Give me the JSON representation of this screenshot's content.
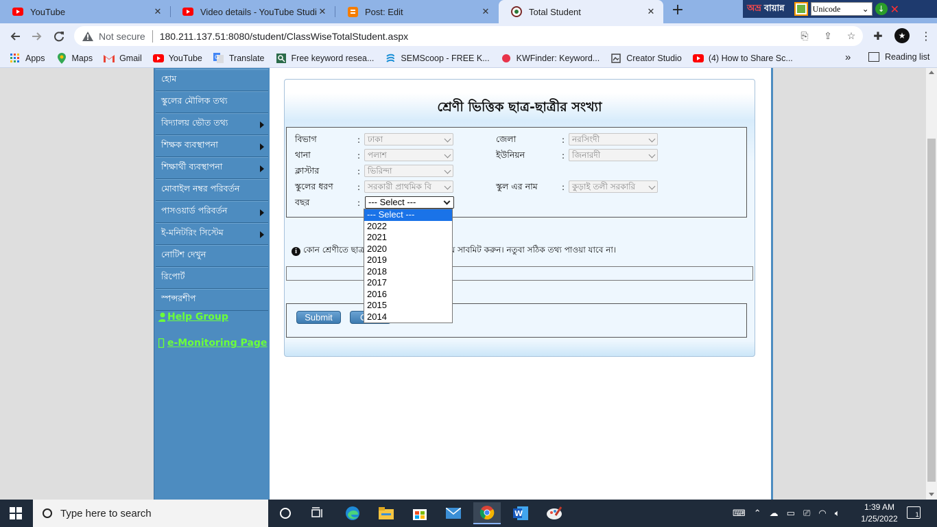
{
  "browser": {
    "tabs": [
      {
        "title": "YouTube",
        "icon": "youtube-icon",
        "active": false
      },
      {
        "title": "Video details - YouTube Studio",
        "icon": "youtube-icon",
        "active": false
      },
      {
        "title": "Post: Edit",
        "icon": "blogger-icon",
        "active": false
      },
      {
        "title": "Total Student",
        "icon": "site-logo-icon",
        "active": true
      }
    ],
    "not_secure_label": "Not secure",
    "url": "180.211.137.51:8080/student/ClassWiseTotalStudent.aspx",
    "bookmarks": [
      {
        "label": "Apps",
        "icon": "apps-grid-icon"
      },
      {
        "label": "Maps",
        "icon": "maps-pin-icon"
      },
      {
        "label": "Gmail",
        "icon": "gmail-icon"
      },
      {
        "label": "YouTube",
        "icon": "youtube-icon"
      },
      {
        "label": "Translate",
        "icon": "translate-icon"
      },
      {
        "label": "Free keyword resea...",
        "icon": "keyword-icon"
      },
      {
        "label": "SEMScoop - FREE K...",
        "icon": "semscoop-icon"
      },
      {
        "label": "KWFinder: Keyword...",
        "icon": "kwfinder-icon"
      },
      {
        "label": "Creator Studio",
        "icon": "creator-studio-icon"
      },
      {
        "label": "(4) How to Share Sc...",
        "icon": "youtube-icon"
      }
    ],
    "reading_list_label": "Reading list",
    "more_bookmarks": "»"
  },
  "ime": {
    "logo_red": "অভ্র",
    "logo_white": "বায়ান্ন",
    "encoding": "Unicode"
  },
  "sidebar": {
    "items": [
      {
        "label": "হোম",
        "has_submenu": false
      },
      {
        "label": "স্কুলের মৌলিক তথ্য",
        "has_submenu": false
      },
      {
        "label": "বিদ্যালয় ভৌত তথ্য",
        "has_submenu": true
      },
      {
        "label": "শিক্ষক ব্যবস্থাপনা",
        "has_submenu": true
      },
      {
        "label": "শিক্ষার্থী ব্যবস্থাপনা",
        "has_submenu": true
      },
      {
        "label": "মোবাইল নম্বর পরিবর্তন",
        "has_submenu": false
      },
      {
        "label": "পাসওয়ার্ড পরিবর্তন",
        "has_submenu": true
      },
      {
        "label": "ই-মনিটরিং সিস্টেম",
        "has_submenu": true
      },
      {
        "label": "নোটিশ দেখুন",
        "has_submenu": false
      },
      {
        "label": "রিপোর্ট",
        "has_submenu": false
      },
      {
        "label": "স্পন্সরশীপ",
        "has_submenu": false
      }
    ],
    "help_group": "Help Group",
    "e_monitoring": "e-Monitoring Page"
  },
  "form": {
    "title": "শ্রেণী ভিত্তিক ছাত্র-ছাত্রীর সংখ্যা",
    "colon": ":",
    "fields": {
      "division": {
        "label": "বিভাগ",
        "value": "ঢাকা"
      },
      "district": {
        "label": "জেলা",
        "value": "নরসিংদী"
      },
      "thana": {
        "label": "থানা",
        "value": "পলাশ"
      },
      "union": {
        "label": "ইউনিয়ন",
        "value": "জিনারদী"
      },
      "cluster": {
        "label": "ক্লাস্টার",
        "value": "ভিরিন্দা"
      },
      "school_type": {
        "label": "স্কুলের ধরণ",
        "value": "সরকারী প্রাথমিক বি"
      },
      "school_name": {
        "label": "স্কুল এর নাম",
        "value": "কুড়াই তলী সরকারি"
      },
      "year": {
        "label": "বছর",
        "value": "--- Select ---"
      }
    },
    "year_options": [
      "--- Select ---",
      "2022",
      "2021",
      "2020",
      "2019",
      "2018",
      "2017",
      "2016",
      "2015",
      "2014"
    ],
    "notice_left": "কোন শ্রেণীতে ছাত্র",
    "notice_right": "ন্য দিয়ে সাবমিট করুন। নতুবা সঠিক তথ্য পাওয়া যাবে না।",
    "submit_label": "Submit",
    "second_button_label": "C"
  },
  "taskbar": {
    "search_placeholder": "Type here to search",
    "time": "1:39 AM",
    "date": "1/25/2022",
    "notification_count": "1"
  },
  "colors": {
    "sidebar": "#4d8cc0",
    "link_green": "#6cff3a",
    "dropdown_selected": "#1a73e8",
    "tabstrip": "#8fb3e6"
  }
}
